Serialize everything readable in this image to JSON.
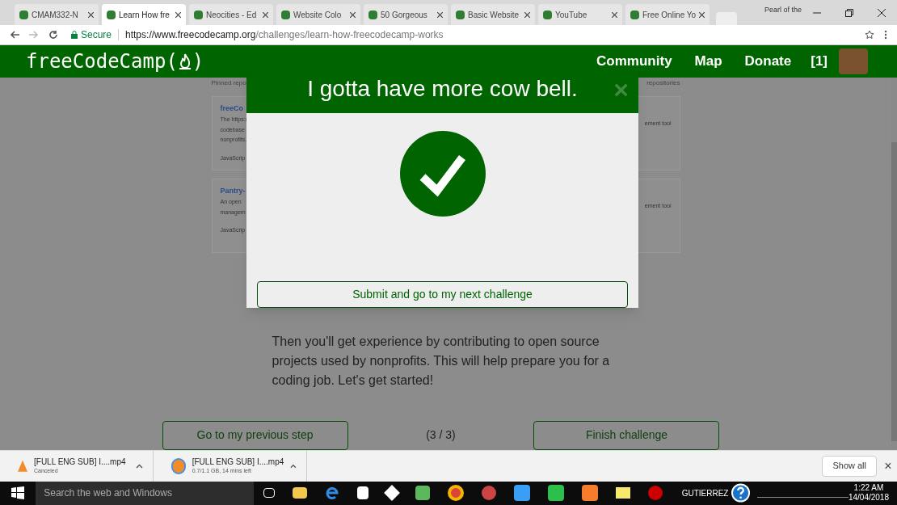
{
  "browser": {
    "tabs": [
      {
        "title": "CMAM332-N",
        "selected": false
      },
      {
        "title": "Learn How fre",
        "selected": true
      },
      {
        "title": "Neocities - Ed",
        "selected": false
      },
      {
        "title": "Website Colo",
        "selected": false
      },
      {
        "title": "50 Gorgeous",
        "selected": false
      },
      {
        "title": "Basic Website",
        "selected": false
      },
      {
        "title": "YouTube",
        "selected": false
      },
      {
        "title": "Free Online Yo",
        "selected": false
      }
    ],
    "profile": "Pearl of the",
    "secure_label": "Secure",
    "url_host": "https://www.freecodecamp.org",
    "url_path": "/challenges/learn-how-freecodecamp-works"
  },
  "site_nav": {
    "logo": "freeCodeCamp(",
    "logo_end": ")",
    "links": [
      "Community",
      "Map",
      "Donate"
    ],
    "points": "[1]"
  },
  "background": {
    "heading_left": "Pinned repo",
    "heading_right": "repositories",
    "cards": [
      {
        "title": "freeCo",
        "lines": [
          "The https:/",
          "codebase",
          "nonprofits."
        ],
        "language": "JavaScrip",
        "right_text": "ement tool"
      },
      {
        "title": "Pantry-",
        "lines": [
          "An open",
          "managem"
        ],
        "language": "JavaScrip",
        "right_text": "ement tool"
      }
    ]
  },
  "lesson": {
    "paragraph": "Then you'll get experience by contributing to open source projects used by nonprofits. This will help prepare you for a coding job. Let's get started!",
    "previous": "Go to my previous step",
    "step": "(3 / 3)",
    "finish": "Finish challenge"
  },
  "modal": {
    "title": "I gotta have more cow bell.",
    "close": "×",
    "submit": "Submit and go to my next challenge"
  },
  "downloads": {
    "items": [
      {
        "name": "[FULL ENG SUB] I....mp4",
        "status": "Canceled",
        "kind": "canceled"
      },
      {
        "name": "[FULL ENG SUB] I....mp4",
        "status": "0.7/1.1 GB, 14 mins left",
        "kind": "progress"
      }
    ],
    "show_all": "Show all",
    "close": "×"
  },
  "taskbar": {
    "search": "Search the web and Windows",
    "user": "GUTIERREZ",
    "time": "1:22 AM",
    "date": "14/04/2018"
  }
}
